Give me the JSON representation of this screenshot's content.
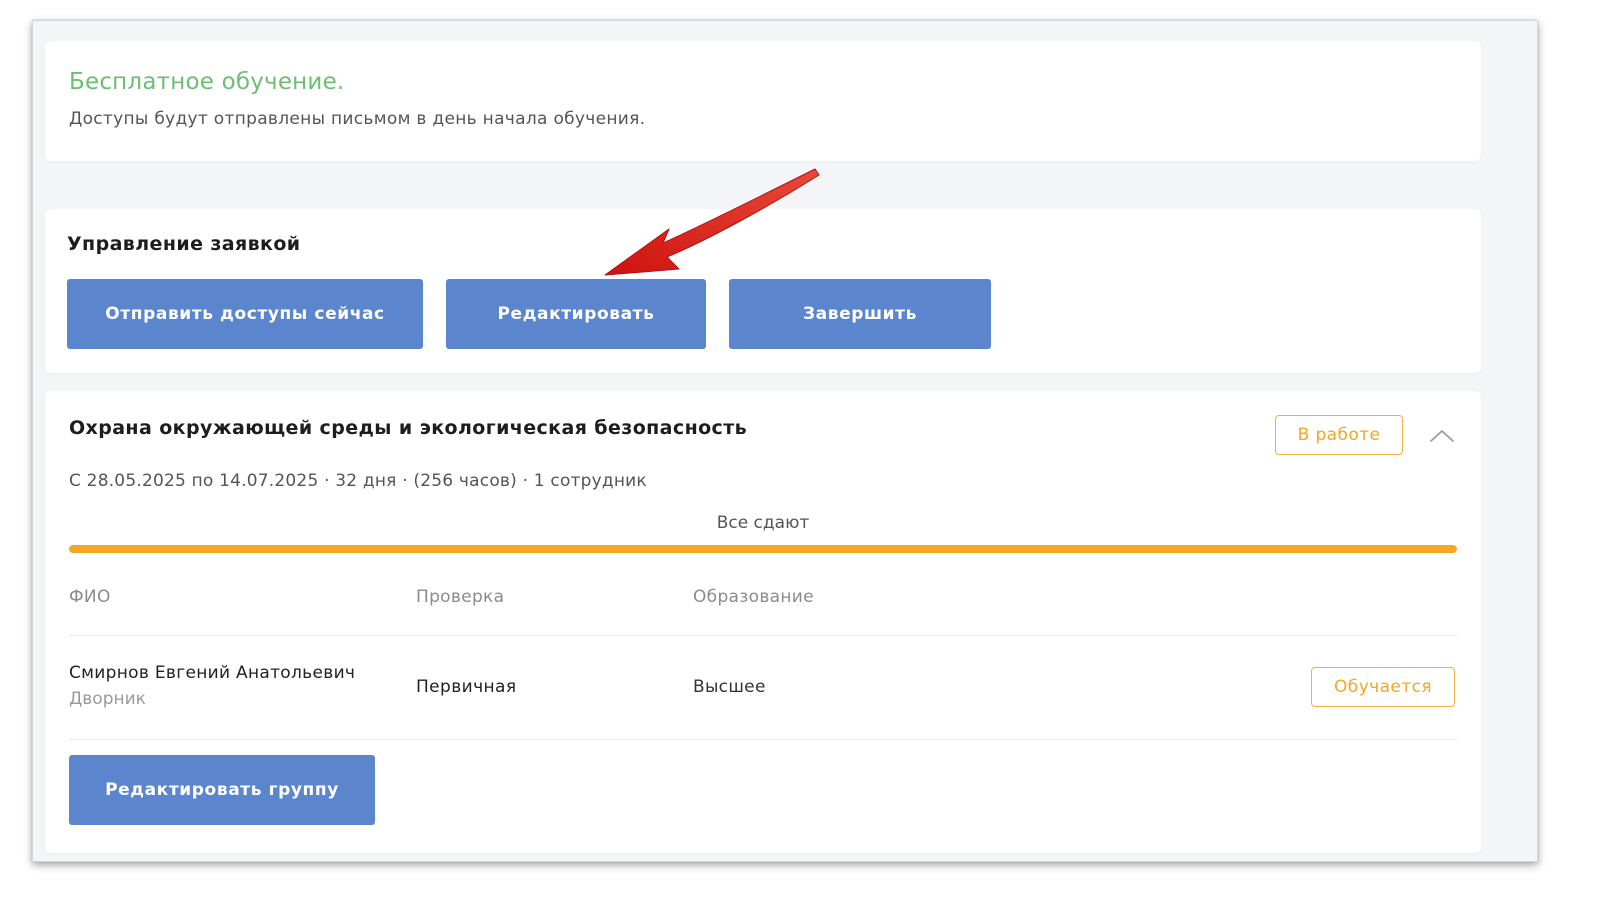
{
  "info": {
    "title": "Бесплатное обучение.",
    "subtitle": "Доступы будут отправлены письмом в день начала обучения."
  },
  "manage": {
    "title": "Управление заявкой",
    "send_access_label": "Отправить доступы сейчас",
    "edit_label": "Редактировать",
    "finish_label": "Завершить"
  },
  "course": {
    "title": "Охрана окружающей среды и экологическая безопасность",
    "status": "В работе",
    "meta": "С 28.05.2025 по 14.07.2025 · 32 дня · (256 часов) · 1 сотрудник",
    "progress_label": "Все сдают",
    "progress_fraction": 1.0,
    "columns": {
      "name": "ФИО",
      "check": "Проверка",
      "education": "Образование"
    },
    "employees": [
      {
        "name": "Смирнов Евгений Анатольевич",
        "role": "Дворник",
        "check": "Первичная",
        "education": "Высшее",
        "status": "Обучается"
      }
    ],
    "edit_group_label": "Редактировать группу"
  },
  "colors": {
    "accent_green": "#6cbf72",
    "button_blue": "#5b85cc",
    "status_orange": "#f5a623",
    "annotation_red": "#e0211d"
  },
  "icons": {
    "collapse": "chevron-up-icon",
    "annotation": "red-arrow-icon"
  }
}
